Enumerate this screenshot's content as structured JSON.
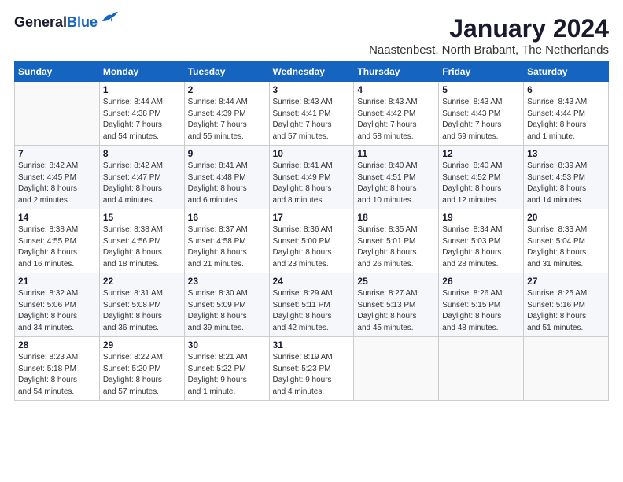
{
  "header": {
    "logo_line1": "General",
    "logo_line2": "Blue",
    "month": "January 2024",
    "location": "Naastenbest, North Brabant, The Netherlands"
  },
  "days_of_week": [
    "Sunday",
    "Monday",
    "Tuesday",
    "Wednesday",
    "Thursday",
    "Friday",
    "Saturday"
  ],
  "weeks": [
    [
      {
        "num": "",
        "info": ""
      },
      {
        "num": "1",
        "info": "Sunrise: 8:44 AM\nSunset: 4:38 PM\nDaylight: 7 hours\nand 54 minutes."
      },
      {
        "num": "2",
        "info": "Sunrise: 8:44 AM\nSunset: 4:39 PM\nDaylight: 7 hours\nand 55 minutes."
      },
      {
        "num": "3",
        "info": "Sunrise: 8:43 AM\nSunset: 4:41 PM\nDaylight: 7 hours\nand 57 minutes."
      },
      {
        "num": "4",
        "info": "Sunrise: 8:43 AM\nSunset: 4:42 PM\nDaylight: 7 hours\nand 58 minutes."
      },
      {
        "num": "5",
        "info": "Sunrise: 8:43 AM\nSunset: 4:43 PM\nDaylight: 7 hours\nand 59 minutes."
      },
      {
        "num": "6",
        "info": "Sunrise: 8:43 AM\nSunset: 4:44 PM\nDaylight: 8 hours\nand 1 minute."
      }
    ],
    [
      {
        "num": "7",
        "info": "Sunrise: 8:42 AM\nSunset: 4:45 PM\nDaylight: 8 hours\nand 2 minutes."
      },
      {
        "num": "8",
        "info": "Sunrise: 8:42 AM\nSunset: 4:47 PM\nDaylight: 8 hours\nand 4 minutes."
      },
      {
        "num": "9",
        "info": "Sunrise: 8:41 AM\nSunset: 4:48 PM\nDaylight: 8 hours\nand 6 minutes."
      },
      {
        "num": "10",
        "info": "Sunrise: 8:41 AM\nSunset: 4:49 PM\nDaylight: 8 hours\nand 8 minutes."
      },
      {
        "num": "11",
        "info": "Sunrise: 8:40 AM\nSunset: 4:51 PM\nDaylight: 8 hours\nand 10 minutes."
      },
      {
        "num": "12",
        "info": "Sunrise: 8:40 AM\nSunset: 4:52 PM\nDaylight: 8 hours\nand 12 minutes."
      },
      {
        "num": "13",
        "info": "Sunrise: 8:39 AM\nSunset: 4:53 PM\nDaylight: 8 hours\nand 14 minutes."
      }
    ],
    [
      {
        "num": "14",
        "info": "Sunrise: 8:38 AM\nSunset: 4:55 PM\nDaylight: 8 hours\nand 16 minutes."
      },
      {
        "num": "15",
        "info": "Sunrise: 8:38 AM\nSunset: 4:56 PM\nDaylight: 8 hours\nand 18 minutes."
      },
      {
        "num": "16",
        "info": "Sunrise: 8:37 AM\nSunset: 4:58 PM\nDaylight: 8 hours\nand 21 minutes."
      },
      {
        "num": "17",
        "info": "Sunrise: 8:36 AM\nSunset: 5:00 PM\nDaylight: 8 hours\nand 23 minutes."
      },
      {
        "num": "18",
        "info": "Sunrise: 8:35 AM\nSunset: 5:01 PM\nDaylight: 8 hours\nand 26 minutes."
      },
      {
        "num": "19",
        "info": "Sunrise: 8:34 AM\nSunset: 5:03 PM\nDaylight: 8 hours\nand 28 minutes."
      },
      {
        "num": "20",
        "info": "Sunrise: 8:33 AM\nSunset: 5:04 PM\nDaylight: 8 hours\nand 31 minutes."
      }
    ],
    [
      {
        "num": "21",
        "info": "Sunrise: 8:32 AM\nSunset: 5:06 PM\nDaylight: 8 hours\nand 34 minutes."
      },
      {
        "num": "22",
        "info": "Sunrise: 8:31 AM\nSunset: 5:08 PM\nDaylight: 8 hours\nand 36 minutes."
      },
      {
        "num": "23",
        "info": "Sunrise: 8:30 AM\nSunset: 5:09 PM\nDaylight: 8 hours\nand 39 minutes."
      },
      {
        "num": "24",
        "info": "Sunrise: 8:29 AM\nSunset: 5:11 PM\nDaylight: 8 hours\nand 42 minutes."
      },
      {
        "num": "25",
        "info": "Sunrise: 8:27 AM\nSunset: 5:13 PM\nDaylight: 8 hours\nand 45 minutes."
      },
      {
        "num": "26",
        "info": "Sunrise: 8:26 AM\nSunset: 5:15 PM\nDaylight: 8 hours\nand 48 minutes."
      },
      {
        "num": "27",
        "info": "Sunrise: 8:25 AM\nSunset: 5:16 PM\nDaylight: 8 hours\nand 51 minutes."
      }
    ],
    [
      {
        "num": "28",
        "info": "Sunrise: 8:23 AM\nSunset: 5:18 PM\nDaylight: 8 hours\nand 54 minutes."
      },
      {
        "num": "29",
        "info": "Sunrise: 8:22 AM\nSunset: 5:20 PM\nDaylight: 8 hours\nand 57 minutes."
      },
      {
        "num": "30",
        "info": "Sunrise: 8:21 AM\nSunset: 5:22 PM\nDaylight: 9 hours\nand 1 minute."
      },
      {
        "num": "31",
        "info": "Sunrise: 8:19 AM\nSunset: 5:23 PM\nDaylight: 9 hours\nand 4 minutes."
      },
      {
        "num": "",
        "info": ""
      },
      {
        "num": "",
        "info": ""
      },
      {
        "num": "",
        "info": ""
      }
    ]
  ]
}
